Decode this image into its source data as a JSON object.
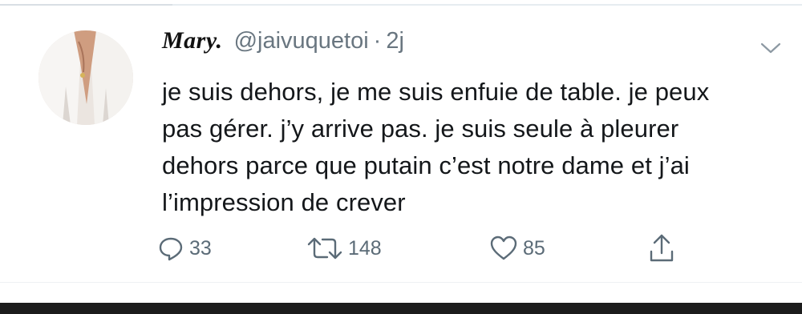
{
  "tweet": {
    "display_name": "Mary.",
    "handle": "@jaivuquetoi",
    "separator": "·",
    "time": "2j",
    "text": "je suis dehors, je me suis enfuie de table. je peux pas gérer. j’y arrive pas. je suis seule à pleurer dehors parce que putain c’est notre dame et j’ai l’impression de crever",
    "actions": {
      "replies": "33",
      "retweets": "148",
      "likes": "85"
    }
  },
  "icons": {
    "reply": "speech-bubble",
    "retweet": "retweet-arrows",
    "like": "heart-outline",
    "share": "share-upload",
    "menu": "chevron-down"
  },
  "colors": {
    "text": "#14171a",
    "muted": "#697680",
    "border": "#e6ecf0"
  }
}
